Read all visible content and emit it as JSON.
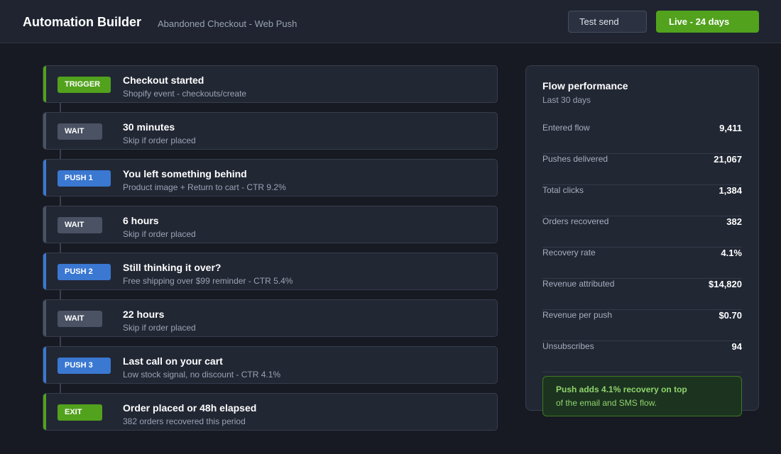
{
  "header": {
    "title": "Automation Builder",
    "flow_name": "Abandoned Checkout - Web Push",
    "test_send_label": "Test send",
    "live_label": "Live - 24 days"
  },
  "colors": {
    "background": "#171a22",
    "panel": "#222734",
    "green_accent": "#52a21d",
    "blue_accent": "#3a78d1",
    "wait_grey": "#4a5264"
  },
  "steps": [
    {
      "kind": "trigger",
      "badge": "TRIGGER",
      "title": "Checkout started",
      "subtitle": "Shopify event - checkouts/create"
    },
    {
      "kind": "wait",
      "badge": "WAIT",
      "title": "30 minutes",
      "subtitle": "Skip if order placed"
    },
    {
      "kind": "push",
      "badge": "PUSH 1",
      "title": "You left something behind",
      "subtitle": "Product image + Return to cart - CTR 9.2%"
    },
    {
      "kind": "wait",
      "badge": "WAIT",
      "title": "6 hours",
      "subtitle": "Skip if order placed"
    },
    {
      "kind": "push",
      "badge": "PUSH 2",
      "title": "Still thinking it over?",
      "subtitle": "Free shipping over $99 reminder - CTR 5.4%"
    },
    {
      "kind": "wait",
      "badge": "WAIT",
      "title": "22 hours",
      "subtitle": "Skip if order placed"
    },
    {
      "kind": "push",
      "badge": "PUSH 3",
      "title": "Last call on your cart",
      "subtitle": "Low stock signal, no discount - CTR 4.1%"
    },
    {
      "kind": "exit",
      "badge": "EXIT",
      "title": "Order placed or 48h elapsed",
      "subtitle": "382 orders recovered this period"
    }
  ],
  "performance": {
    "title": "Flow performance",
    "subtitle": "Last 30 days",
    "metrics": [
      {
        "label": "Entered flow",
        "value": "9,411"
      },
      {
        "label": "Pushes delivered",
        "value": "21,067"
      },
      {
        "label": "Total clicks",
        "value": "1,384"
      },
      {
        "label": "Orders recovered",
        "value": "382"
      },
      {
        "label": "Recovery rate",
        "value": "4.1%"
      },
      {
        "label": "Revenue attributed",
        "value": "$14,820"
      },
      {
        "label": "Revenue per push",
        "value": "$0.70"
      },
      {
        "label": "Unsubscribes",
        "value": "94"
      }
    ],
    "callout_line1": "Push adds 4.1% recovery on top",
    "callout_line2": "of the email and SMS flow."
  }
}
